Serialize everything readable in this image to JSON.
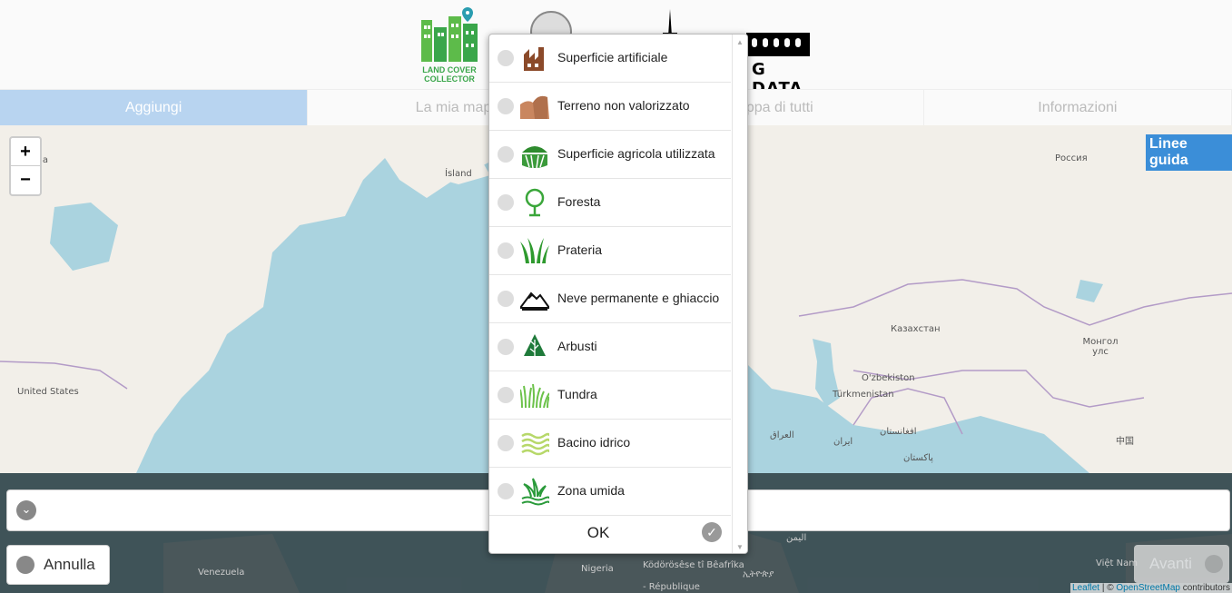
{
  "header": {
    "logo_lcc_text": "LAND COVER COLLECTOR",
    "logo_bigdata_text": "G DATA"
  },
  "tabs": [
    {
      "label": "Aggiungi",
      "active": true
    },
    {
      "label": "La mia mappa",
      "active": false
    },
    {
      "label": "Mappa di tutti",
      "active": false
    },
    {
      "label": "Informazioni",
      "active": false
    }
  ],
  "map": {
    "zoom_in": "+",
    "zoom_out": "−",
    "guide_button": "Linee guida",
    "labels": [
      {
        "text": "nada"
      },
      {
        "text": "Ísland"
      },
      {
        "text": "Россия"
      },
      {
        "text": "Казахстан"
      },
      {
        "text": "Монгол улс"
      },
      {
        "text": "O'zbekiston"
      },
      {
        "text": "Türkmenistan"
      },
      {
        "text": "United States"
      },
      {
        "text": "العراق"
      },
      {
        "text": "ایران"
      },
      {
        "text": "افغانستان"
      },
      {
        "text": "پاکستان"
      },
      {
        "text": "中国"
      },
      {
        "text": "Venezuela"
      },
      {
        "text": "Nigeria"
      },
      {
        "text": "Ködörösêse tî Bêafrîka"
      },
      {
        "text": "- République"
      },
      {
        "text": "ኢትዮጵያ"
      },
      {
        "text": "اليمن"
      },
      {
        "text": "Việt Nam"
      }
    ],
    "attribution_leaflet": "Leaflet",
    "attribution_sep": " | © ",
    "attribution_osm": "OpenStreetMap",
    "attribution_tail": " contributors"
  },
  "bottom": {
    "cancel_label": "Annulla",
    "next_label": "Avanti"
  },
  "popup": {
    "options": [
      {
        "label": "Superficie artificiale",
        "icon": "building-icon"
      },
      {
        "label": "Terreno non valorizzato",
        "icon": "bare-ground-icon"
      },
      {
        "label": "Superficie agricola utilizzata",
        "icon": "farmland-icon"
      },
      {
        "label": "Foresta",
        "icon": "tree-icon"
      },
      {
        "label": "Prateria",
        "icon": "grass-icon"
      },
      {
        "label": "Neve permanente e ghiaccio",
        "icon": "snow-mountain-icon"
      },
      {
        "label": "Arbusti",
        "icon": "shrub-icon"
      },
      {
        "label": "Tundra",
        "icon": "tundra-icon"
      },
      {
        "label": "Bacino idrico",
        "icon": "water-icon"
      },
      {
        "label": "Zona umida",
        "icon": "wetland-icon"
      }
    ],
    "ok_label": "OK"
  },
  "colors": {
    "active_tab": "#b8d4f0",
    "guide_button": "#3b8ed8",
    "sea": "#aad3df",
    "land": "#f2efe9"
  }
}
